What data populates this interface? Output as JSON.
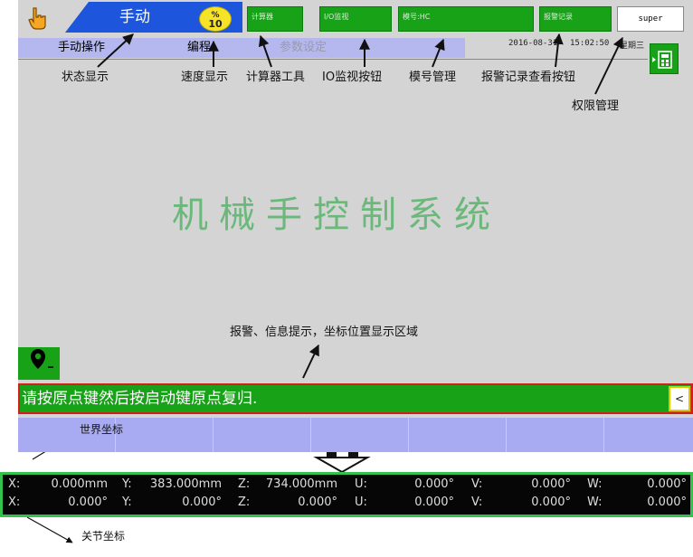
{
  "topbar": {
    "mode_label": "手动",
    "speed_top": "%",
    "speed_value": "10",
    "calc_button": "计算器",
    "io_button": "I/O监视",
    "mold_button": "模号:HC",
    "alarm_button": "报警记录",
    "user": "super"
  },
  "tabs": [
    "手动操作",
    "编程",
    "参数设定"
  ],
  "datetime": {
    "date": "2016-08-31",
    "time": "15:02:50",
    "weekday": "星期三"
  },
  "annotations": {
    "status": "状态显示",
    "speed": "速度显示",
    "calculator": "计算器工具",
    "io": "IO监视按钮",
    "mold": "模号管理",
    "alarm": "报警记录查看按钮",
    "permission": "权限管理",
    "info_area": "报警、信息提示，坐标位置显示区域",
    "world": "世界坐标",
    "joint": "关节坐标"
  },
  "main_title": "机械手控制系统",
  "message": "请按原点键然后按启动键原点复归.",
  "message_button": "<",
  "coords": {
    "world": [
      {
        "axis": "X:",
        "value": "0.000mm"
      },
      {
        "axis": "Y:",
        "value": "383.000mm"
      },
      {
        "axis": "Z:",
        "value": "734.000mm"
      },
      {
        "axis": "U:",
        "value": "0.000°"
      },
      {
        "axis": "V:",
        "value": "0.000°"
      },
      {
        "axis": "W:",
        "value": "0.000°"
      }
    ],
    "joint": [
      {
        "axis": "X:",
        "value": "0.000°"
      },
      {
        "axis": "Y:",
        "value": "0.000°"
      },
      {
        "axis": "Z:",
        "value": "0.000°"
      },
      {
        "axis": "U:",
        "value": "0.000°"
      },
      {
        "axis": "V:",
        "value": "0.000°"
      },
      {
        "axis": "W:",
        "value": "0.000°"
      }
    ]
  },
  "colors": {
    "status_green": "#18a218",
    "mode_blue": "#1d55dc",
    "alert_red": "#d21e1e",
    "tab_lavender": "#b4b8ee"
  }
}
